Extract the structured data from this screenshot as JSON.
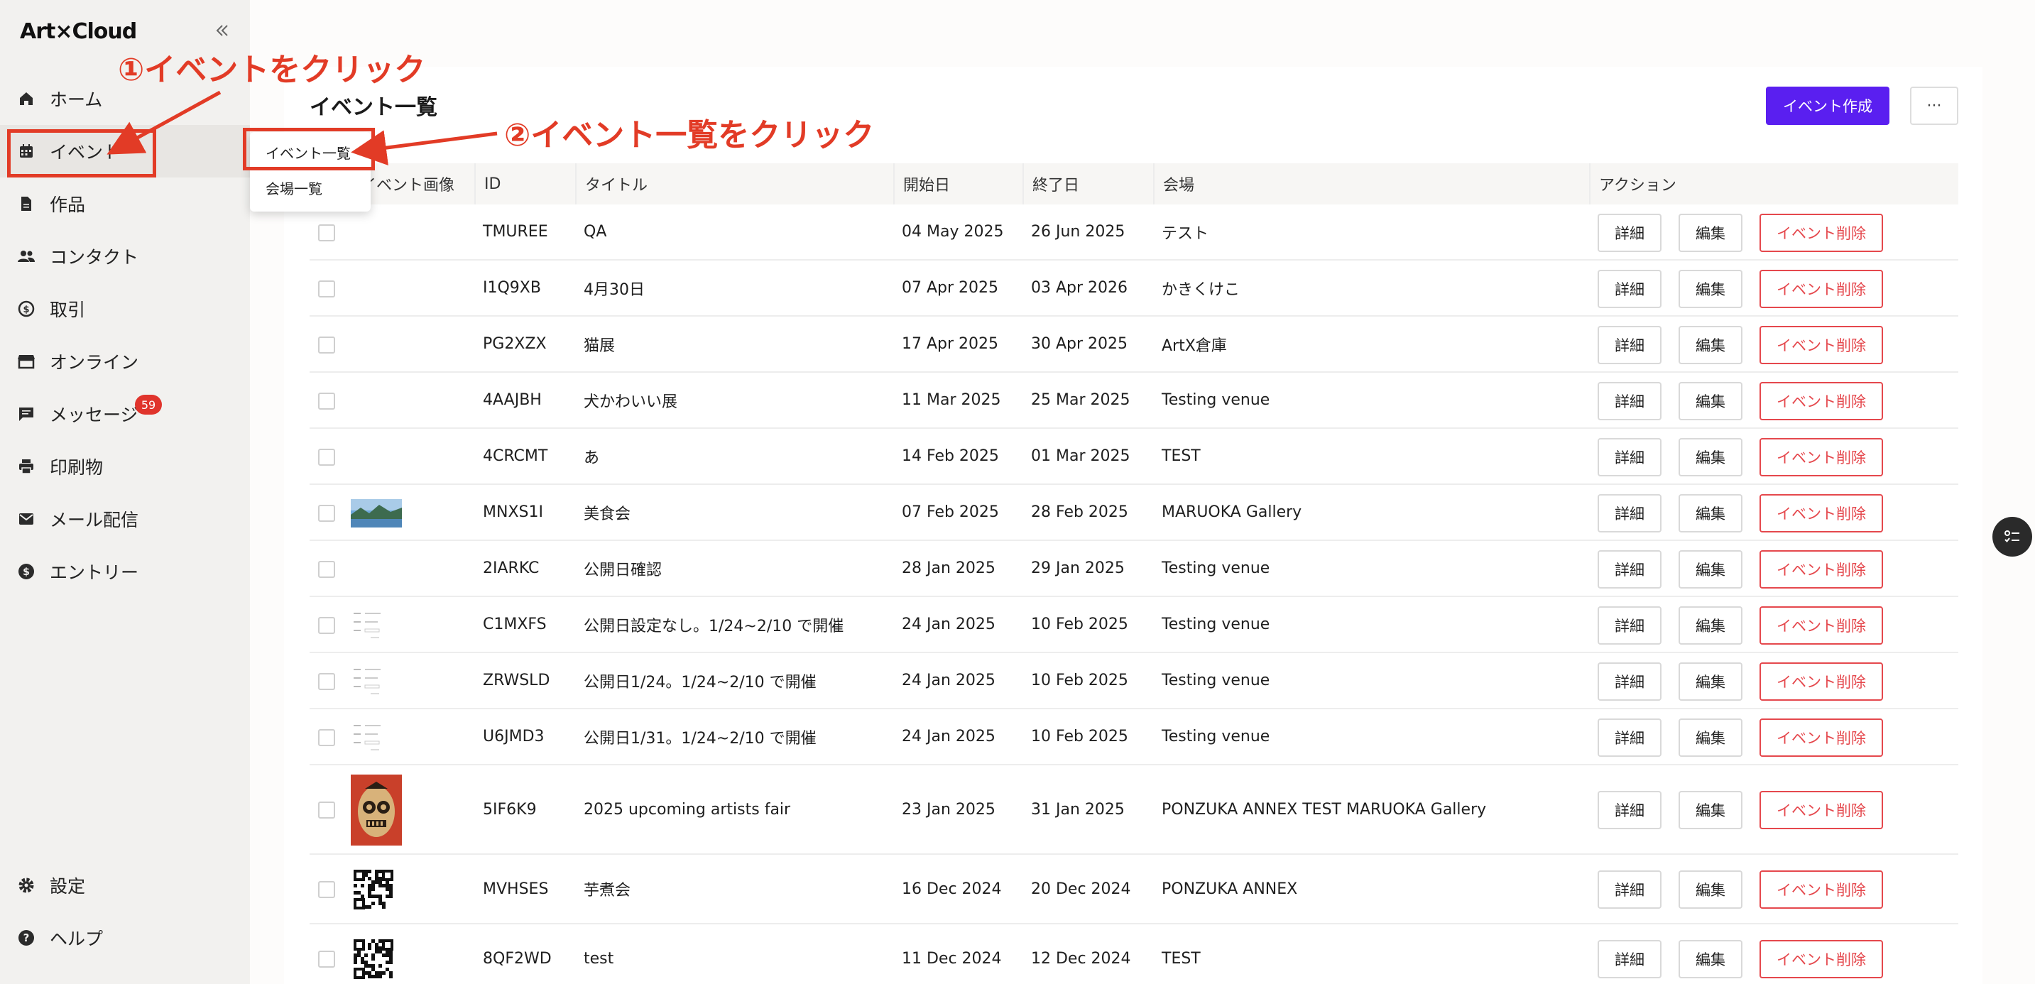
{
  "sidebar": {
    "logo": "Art×Cloud",
    "items": [
      {
        "label": "ホーム",
        "icon": "home-icon"
      },
      {
        "label": "イベント",
        "icon": "calendar-icon"
      },
      {
        "label": "作品",
        "icon": "document-icon"
      },
      {
        "label": "コンタクト",
        "icon": "people-icon"
      },
      {
        "label": "取引",
        "icon": "transaction-icon"
      },
      {
        "label": "オンライン",
        "icon": "store-icon"
      },
      {
        "label": "メッセージ",
        "icon": "chat-icon",
        "badge": "59"
      },
      {
        "label": "印刷物",
        "icon": "print-icon"
      },
      {
        "label": "メール配信",
        "icon": "mail-icon"
      },
      {
        "label": "エントリー",
        "icon": "dollar-icon"
      }
    ],
    "bottom_items": [
      {
        "label": "設定",
        "icon": "gear-icon"
      },
      {
        "label": "ヘルプ",
        "icon": "help-icon"
      }
    ]
  },
  "dropdown": {
    "items": [
      "イベント一覧",
      "会場一覧"
    ]
  },
  "header": {
    "title": "イベント一覧",
    "create_button": "イベント作成",
    "more_button": "···"
  },
  "table": {
    "columns": [
      "イベント画像",
      "ID",
      "タイトル",
      "開始日",
      "終了日",
      "会場",
      "アクション"
    ],
    "rows": [
      {
        "id": "TMUREE",
        "title": "QA",
        "start": "04 May 2025",
        "end": "26 Jun 2025",
        "venue": "テスト",
        "image": "none"
      },
      {
        "id": "I1Q9XB",
        "title": "4月30日",
        "start": "07 Apr 2025",
        "end": "03 Apr 2026",
        "venue": "かきくけこ",
        "image": "none"
      },
      {
        "id": "PG2XZX",
        "title": "猫展",
        "start": "17 Apr 2025",
        "end": "30 Apr 2025",
        "venue": "ArtX倉庫",
        "image": "none"
      },
      {
        "id": "4AAJBH",
        "title": "犬かわいい展",
        "start": "11 Mar 2025",
        "end": "25 Mar 2025",
        "venue": "Testing venue",
        "image": "none"
      },
      {
        "id": "4CRCMT",
        "title": "あ",
        "start": "14 Feb 2025",
        "end": "01 Mar 2025",
        "venue": "TEST",
        "image": "none"
      },
      {
        "id": "MNXS1I",
        "title": "美食会",
        "start": "07 Feb 2025",
        "end": "28 Feb 2025",
        "venue": "MARUOKA Gallery",
        "image": "landscape"
      },
      {
        "id": "2IARKC",
        "title": "公開日確認",
        "start": "28 Jan 2025",
        "end": "29 Jan 2025",
        "venue": "Testing venue",
        "image": "none"
      },
      {
        "id": "C1MXFS",
        "title": "公開日設定なし。1/24~2/10 で開催",
        "start": "24 Jan 2025",
        "end": "10 Feb 2025",
        "venue": "Testing venue",
        "image": "doc"
      },
      {
        "id": "ZRWSLD",
        "title": "公開日1/24。1/24~2/10 で開催",
        "start": "24 Jan 2025",
        "end": "10 Feb 2025",
        "venue": "Testing venue",
        "image": "doc"
      },
      {
        "id": "U6JMD3",
        "title": "公開日1/31。1/24~2/10 で開催",
        "start": "24 Jan 2025",
        "end": "10 Feb 2025",
        "venue": "Testing venue",
        "image": "doc"
      },
      {
        "id": "5IF6K9",
        "title": "2025 upcoming artists fair",
        "start": "23 Jan 2025",
        "end": "31 Jan 2025",
        "venue": "PONZUKA ANNEX TEST MARUOKA Gallery",
        "image": "mask"
      },
      {
        "id": "MVHSES",
        "title": "芋煮会",
        "start": "16 Dec 2024",
        "end": "20 Dec 2024",
        "venue": "PONZUKA ANNEX",
        "image": "qr"
      },
      {
        "id": "8QF2WD",
        "title": "test",
        "start": "11 Dec 2024",
        "end": "12 Dec 2024",
        "venue": "TEST",
        "image": "qr"
      }
    ],
    "action_labels": {
      "detail": "詳細",
      "edit": "編集",
      "delete": "イベント削除"
    }
  },
  "annotations": {
    "step1": "①イベントをクリック",
    "step2": "②イベント一覧をクリック"
  },
  "colors": {
    "accent": "#5a1ff0",
    "danger": "#e5484d",
    "annotation": "#e23b26",
    "badge": "#e0342c"
  }
}
